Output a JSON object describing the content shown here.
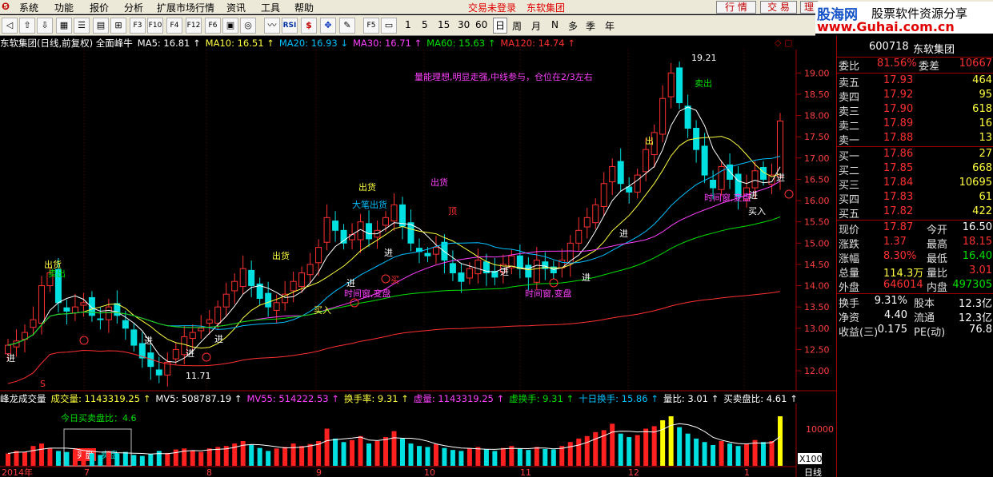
{
  "menu": {
    "items": [
      "系统",
      "功能",
      "报价",
      "分析",
      "扩展市场行情",
      "资讯",
      "工具",
      "帮助"
    ],
    "login_status": "交易未登录",
    "stock_name": "东软集团",
    "btn_quote": "行 情",
    "btn_trade": "交 易",
    "btn_extra": "理"
  },
  "brand": {
    "logo": "股海网",
    "slogan": "股票软件资源分享",
    "url": "www.Guhai.com.cn"
  },
  "toolbar": {
    "icons": [
      "back-icon",
      "up-arrow-icon",
      "down-arrow-icon",
      "grid-icon",
      "table-icon",
      "f10-icon",
      "f3-icon",
      "f4-icon",
      "f12-icon",
      "f6-icon",
      "target-icon",
      "line-chart-icon",
      "rsi-icon",
      "dollar-icon",
      "move-icon",
      "edit-icon",
      "f5-icon",
      "window-icon"
    ],
    "periods": [
      "1",
      "5",
      "15",
      "30",
      "60",
      "日",
      "周",
      "月",
      "N",
      "多",
      "季",
      "年"
    ],
    "active_period": "日"
  },
  "main": {
    "title": "东软集团(日线,前复权) 全面峰牛",
    "ma": [
      {
        "label": "MA5: 16.81",
        "arrow": "↑",
        "color": "#ffffff"
      },
      {
        "label": "MA10: 16.51",
        "arrow": "↑",
        "color": "#ffff40"
      },
      {
        "label": "MA20: 16.93",
        "arrow": "↓",
        "color": "#00c0ff"
      },
      {
        "label": "MA30: 16.71",
        "arrow": "↑",
        "color": "#ff40ff"
      },
      {
        "label": "MA60: 15.63",
        "arrow": "↑",
        "color": "#00e000"
      },
      {
        "label": "MA120: 14.74",
        "arrow": "↑",
        "color": "#ff3030"
      }
    ],
    "comment": "量能理想,明显走强,中线参与，仓位在2/3左右",
    "price_axis": [
      "19.00",
      "18.50",
      "18.00",
      "17.50",
      "17.00",
      "16.50",
      "16.00",
      "15.50",
      "15.00",
      "14.50",
      "14.00",
      "13.50",
      "13.00",
      "12.50",
      "12.00"
    ],
    "high_label": "19.21",
    "low_label": "11.71",
    "annotations": [
      {
        "text": "出货",
        "color": "#ffff40"
      },
      {
        "text": "卖出",
        "color": "#00e000"
      },
      {
        "text": "出货",
        "color": "#ffff40"
      },
      {
        "text": "大笔出货",
        "color": "#00c0ff"
      },
      {
        "text": "出货",
        "color": "#ffff40"
      },
      {
        "text": "出货",
        "color": "#ff40ff"
      },
      {
        "text": "顶",
        "color": "#ff3030"
      },
      {
        "text": "卖出",
        "color": "#00e000"
      },
      {
        "text": "出",
        "color": "#ffff40"
      },
      {
        "text": "进",
        "color": "#ffffff"
      },
      {
        "text": "买",
        "color": "#ff3030"
      },
      {
        "text": "买入",
        "color": "#ffff40"
      },
      {
        "text": "买入",
        "color": "#ffffff"
      },
      {
        "text": "时间窗,变盘",
        "color": "#ff40ff"
      },
      {
        "text": "时间窗,变盘",
        "color": "#ff40ff"
      },
      {
        "text": "时间窗,变盘",
        "color": "#ff40ff"
      },
      {
        "text": "S",
        "color": "#ff3030"
      }
    ]
  },
  "volume": {
    "title": "峰龙成交量",
    "labels": [
      {
        "label": "成交量: 1143319.25",
        "arrow": "↑",
        "color": "#ffff40"
      },
      {
        "label": "MV5: 508787.19",
        "arrow": "↑",
        "color": "#ffffff"
      },
      {
        "label": "MV55: 514222.53",
        "arrow": "↑",
        "color": "#ff40ff"
      },
      {
        "label": "换手率: 9.31",
        "arrow": "↑",
        "color": "#ffff40"
      },
      {
        "label": "虚量: 1143319.25",
        "arrow": "↑",
        "color": "#ff40ff"
      },
      {
        "label": "虚换手: 9.31",
        "arrow": "↑",
        "color": "#00e000"
      },
      {
        "label": "十日换手: 15.86",
        "arrow": "↑",
        "color": "#00c0ff"
      },
      {
        "label": "量比: 3.01",
        "arrow": "↑",
        "color": "#ffffff"
      },
      {
        "label": "买卖盘比: 4.61",
        "arrow": "↑",
        "color": "#ffffff"
      }
    ],
    "today_ratio": "今日买卖盘比：4.6",
    "buy_label": "买盘",
    "sell_label": "卖盘",
    "axis_label": "10000",
    "unit_label": "X100",
    "date_labels": [
      "2014年",
      "7",
      "8",
      "9",
      "10",
      "11",
      "12",
      "1"
    ],
    "period_label": "日线"
  },
  "quote": {
    "code": "600718",
    "name": "东软集团",
    "header": {
      "label1": "委比",
      "val1": "81.56%",
      "label2": "委差",
      "val2": "10667"
    },
    "sells": [
      {
        "label": "卖五",
        "price": "17.93",
        "vol": "464"
      },
      {
        "label": "卖四",
        "price": "17.92",
        "vol": "95"
      },
      {
        "label": "卖三",
        "price": "17.90",
        "vol": "618"
      },
      {
        "label": "卖二",
        "price": "17.89",
        "vol": "16"
      },
      {
        "label": "卖一",
        "price": "17.88",
        "vol": "13"
      }
    ],
    "buys": [
      {
        "label": "买一",
        "price": "17.86",
        "vol": "27"
      },
      {
        "label": "买二",
        "price": "17.85",
        "vol": "668"
      },
      {
        "label": "买三",
        "price": "17.84",
        "vol": "10695"
      },
      {
        "label": "买四",
        "price": "17.83",
        "vol": "61"
      },
      {
        "label": "买五",
        "price": "17.82",
        "vol": "422"
      }
    ],
    "stats1": [
      {
        "l1": "现价",
        "v1": "17.87",
        "l2": "今开",
        "v2": "16.50"
      },
      {
        "l1": "涨跌",
        "v1": "1.37",
        "l2": "最高",
        "v2": "18.15"
      },
      {
        "l1": "涨幅",
        "v1": "8.30%",
        "l2": "最低",
        "v2": "16.40"
      },
      {
        "l1": "总量",
        "v1": "114.3万",
        "l2": "量比",
        "v2": "3.01"
      },
      {
        "l1": "外盘",
        "v1": "646014",
        "l2": "内盘",
        "v2": "497305"
      }
    ],
    "stats2": [
      {
        "l1": "换手",
        "v1": "9.31%",
        "l2": "股本",
        "v2": "12.3亿"
      },
      {
        "l1": "净资",
        "v1": "4.40",
        "l2": "流通",
        "v2": "12.3亿"
      },
      {
        "l1": "收益(三)",
        "v1": "0.175",
        "l2": "PE(动)",
        "v2": "76.8"
      }
    ]
  },
  "chart_data": {
    "type": "candlestick",
    "series_close": [
      12.6,
      12.7,
      12.9,
      13.2,
      14.0,
      14.3,
      13.6,
      13.4,
      13.5,
      13.6,
      13.3,
      13.2,
      13.5,
      13.3,
      13.0,
      12.6,
      12.3,
      12.1,
      11.9,
      12.2,
      12.5,
      12.8,
      12.9,
      13.0,
      13.2,
      13.5,
      13.8,
      14.1,
      14.4,
      14.0,
      13.7,
      13.5,
      13.6,
      13.8,
      14.1,
      14.3,
      14.5,
      14.9,
      15.6,
      15.3,
      15.0,
      15.2,
      15.5,
      15.1,
      15.3,
      15.6,
      15.9,
      15.4,
      15.0,
      14.8,
      14.7,
      14.9,
      14.6,
      14.3,
      14.1,
      14.4,
      14.6,
      14.3,
      14.2,
      14.5,
      14.7,
      14.4,
      14.2,
      14.6,
      14.4,
      14.3,
      14.6,
      15.0,
      15.3,
      15.6,
      15.9,
      16.4,
      16.8,
      16.4,
      16.2,
      16.6,
      17.2,
      17.6,
      18.4,
      19.0,
      18.3,
      17.7,
      17.2,
      16.6,
      16.3,
      16.8,
      16.5,
      16.1,
      16.3,
      16.7,
      16.5,
      16.6,
      17.87
    ],
    "ma_names": [
      "MA5",
      "MA10",
      "MA20",
      "MA30",
      "MA60",
      "MA120"
    ],
    "ylim": [
      11.71,
      19.21
    ],
    "volume": [
      25,
      30,
      28,
      40,
      45,
      35,
      30,
      28,
      33,
      30,
      25,
      22,
      30,
      25,
      28,
      22,
      20,
      24,
      30,
      26,
      33,
      35,
      30,
      28,
      35,
      38,
      40,
      45,
      50,
      42,
      36,
      30,
      35,
      38,
      45,
      40,
      44,
      50,
      75,
      55,
      48,
      52,
      60,
      45,
      50,
      58,
      70,
      55,
      45,
      40,
      38,
      44,
      36,
      32,
      30,
      35,
      38,
      33,
      30,
      36,
      40,
      35,
      32,
      38,
      34,
      33,
      40,
      48,
      55,
      60,
      68,
      72,
      85,
      65,
      58,
      62,
      75,
      80,
      92,
      100,
      78,
      65,
      55,
      48,
      42,
      50,
      45,
      40,
      44,
      52,
      48,
      50,
      100
    ]
  }
}
